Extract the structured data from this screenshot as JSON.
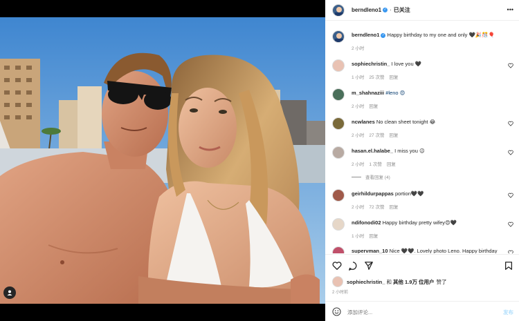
{
  "post": {
    "author": "berndleno1",
    "follow_label": "已关注",
    "more_icon": "more-horizontal-icon",
    "caption_text": "Happy birthday to my one and only 🖤🎉🎊🎈",
    "caption_time": "2 小时",
    "tag_icon": "user-tag-icon"
  },
  "comments": [
    {
      "user": "sophiechristin_",
      "text": "I love you 🖤",
      "time": "1 小时",
      "likes": "25 次赞",
      "reply": "回复"
    },
    {
      "user": "m_shahnaziii",
      "text": "#leno 😍",
      "time": "2 小时",
      "likes": "",
      "reply": "回复"
    },
    {
      "user": "ncwlanes",
      "text": "No clean sheet tonight 😂",
      "time": "2 小时",
      "likes": "27 次赞",
      "reply": "回复"
    },
    {
      "user": "hasan.el.halabe_",
      "text": "I miss you 😉",
      "time": "2 小时",
      "likes": "1 次赞",
      "reply": "回复"
    },
    {
      "user": "geirhildurpappas",
      "text": "portion🖤🖤",
      "time": "2 小时",
      "likes": "72 次赞",
      "reply": "回复"
    },
    {
      "user": "ndifonodi02",
      "text": "Happy birthday pretty wifey😍🖤",
      "time": "1 小时",
      "likes": "",
      "reply": "回复"
    },
    {
      "user": "supervman_10",
      "text": "Nice 🖤🖤. Lovely photo Leno. Happy birthday",
      "time": "",
      "likes": "",
      "reply": ""
    }
  ],
  "view_replies": "查看回复 (4)",
  "actions": {
    "like_icon": "heart-icon",
    "comment_icon": "comment-icon",
    "share_icon": "send-icon",
    "save_icon": "bookmark-icon"
  },
  "liked_by": {
    "user": "sophiechristin_",
    "connector": "和",
    "others": "其他 1.9万 位用户",
    "suffix": "赞了"
  },
  "post_age": "2 小时前",
  "comment_box": {
    "emoji_icon": "smiley-icon",
    "placeholder": "添加评论...",
    "post_label": "发布"
  },
  "colors": {
    "verified": "#3897f0",
    "post_button": "#b2dffc",
    "meta_text": "#8e8e8e"
  }
}
